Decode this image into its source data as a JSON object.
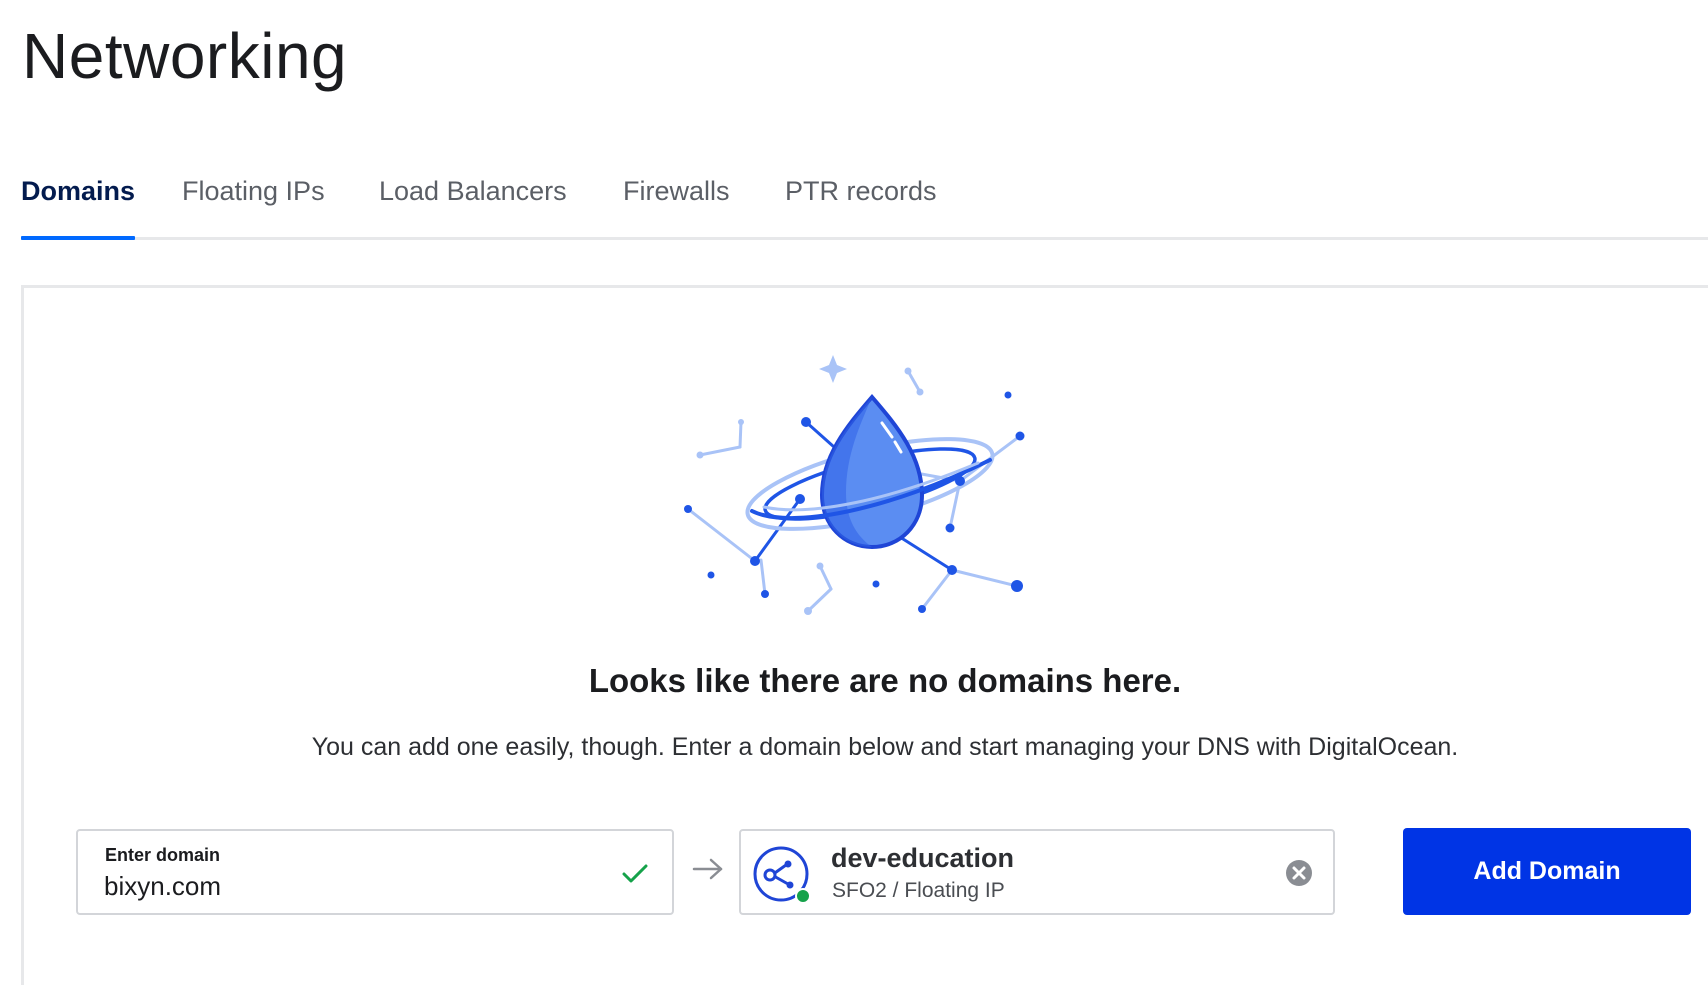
{
  "page": {
    "title": "Networking"
  },
  "tabs": [
    {
      "label": "Domains",
      "active": true
    },
    {
      "label": "Floating IPs",
      "active": false
    },
    {
      "label": "Load Balancers",
      "active": false
    },
    {
      "label": "Firewalls",
      "active": false
    },
    {
      "label": "PTR records",
      "active": false
    }
  ],
  "empty_state": {
    "heading": "Looks like there are no domains here.",
    "subtext": "You can add one easily, though. Enter a domain below and start managing your DNS with DigitalOcean.",
    "illustration_icon": "droplet-planet-illustration"
  },
  "domain_form": {
    "domain_label": "Enter domain",
    "domain_value": "bixyn.com",
    "valid_icon": "check-icon",
    "arrow_icon": "arrow-right-icon",
    "target": {
      "icon": "floating-ip-share-icon",
      "name": "dev-education",
      "meta": "SFO2 / Floating IP",
      "status": "active",
      "clear_icon": "clear-circle-icon"
    },
    "submit_label": "Add Domain"
  },
  "colors": {
    "accent": "#0069ff",
    "button": "#0034e5",
    "check": "#15a24a",
    "status_active": "#15a24a",
    "heading": "#031b4e"
  }
}
